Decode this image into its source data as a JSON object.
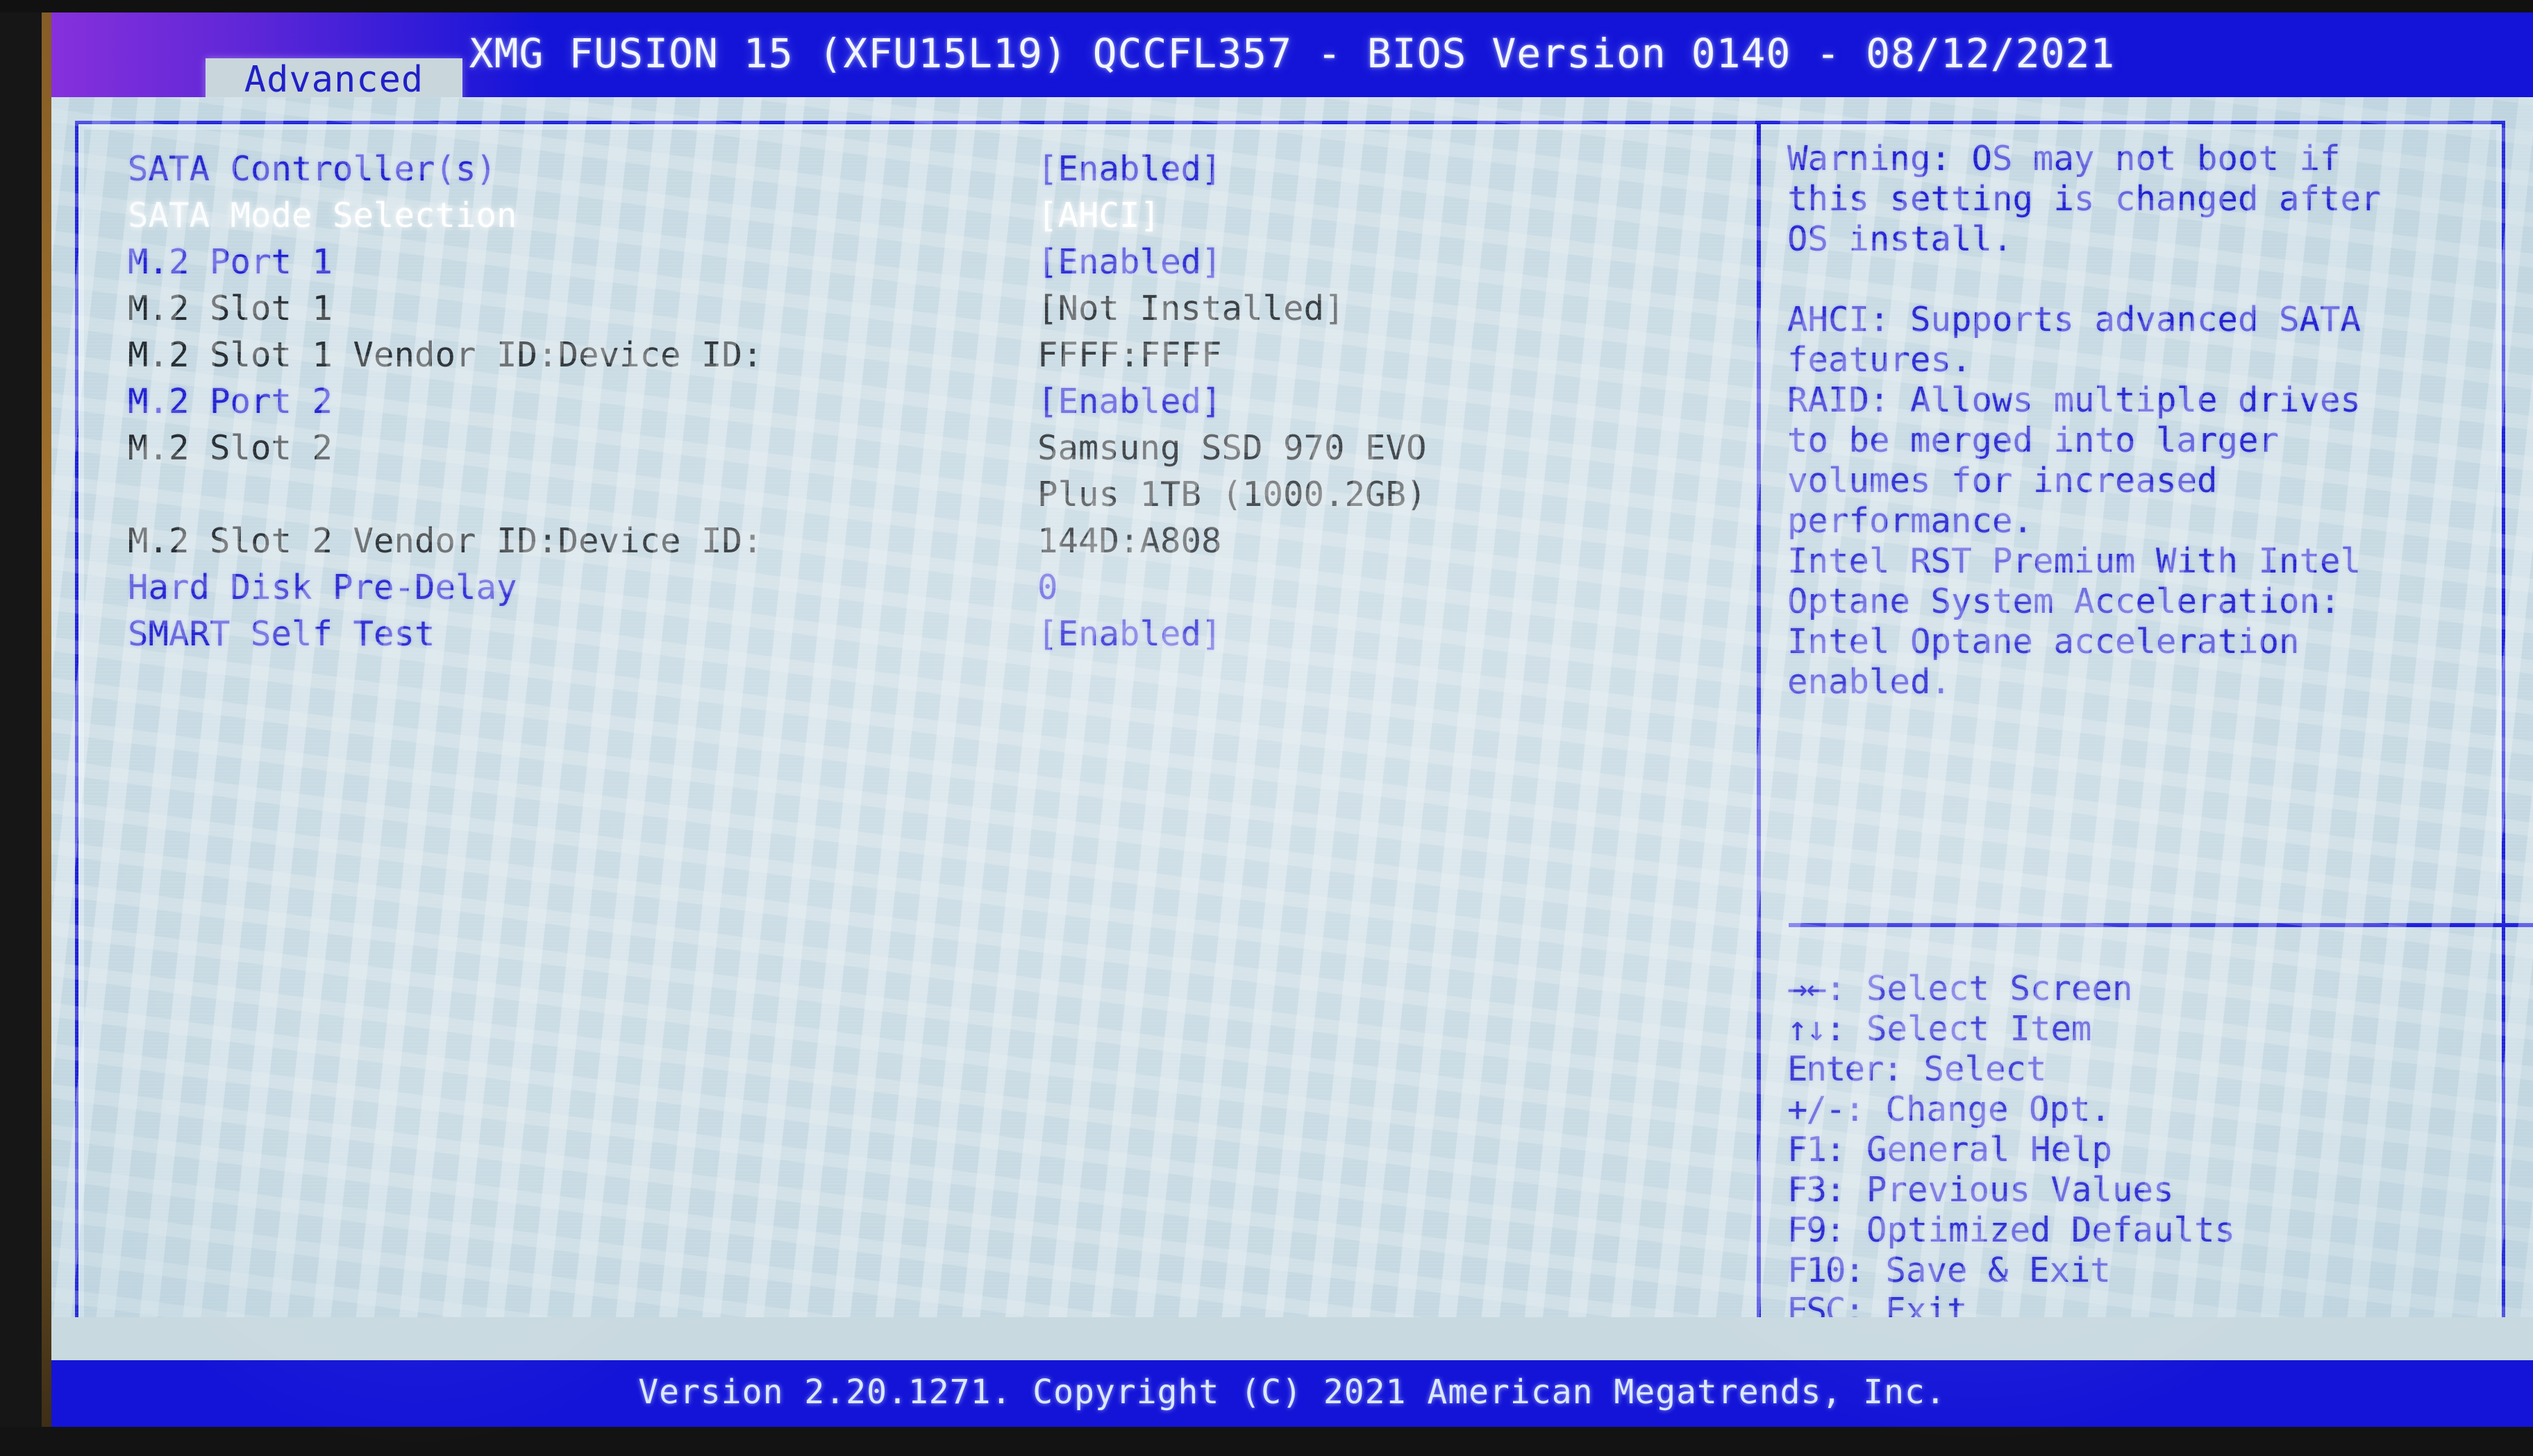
{
  "header": {
    "title": "XMG FUSION 15 (XFU15L19) QCCFL357 - BIOS Version 0140 - 08/12/2021",
    "active_tab": "Advanced",
    "accent_blue": "#1414d8",
    "option_blue": "#1f1fcf",
    "selected_white": "#ffffff",
    "info_dark": "#23292e",
    "screen_bg": "#c6d9e2"
  },
  "settings": [
    {
      "label": "SATA Controller(s)",
      "value": "[Enabled]",
      "label_style": "option",
      "value_style": "option"
    },
    {
      "label": "SATA Mode Selection",
      "value": "[AHCI]",
      "label_style": "selected",
      "value_style": "selected"
    },
    {
      "label": "M.2 Port 1",
      "value": "[Enabled]",
      "label_style": "option",
      "value_style": "option"
    },
    {
      "label": "M.2 Slot 1",
      "value": "[Not Installed]",
      "label_style": "info",
      "value_style": "info"
    },
    {
      "label": "M.2 Slot 1 Vendor ID:Device ID:",
      "value": "FFFF:FFFF",
      "label_style": "info",
      "value_style": "info"
    },
    {
      "label": "M.2 Port 2",
      "value": "[Enabled]",
      "label_style": "option",
      "value_style": "option"
    },
    {
      "label": "M.2 Slot 2",
      "value": "Samsung SSD 970 EVO\nPlus 1TB (1000.2GB)",
      "label_style": "info",
      "value_style": "info",
      "tall": true
    },
    {
      "label": "M.2 Slot 2 Vendor ID:Device ID:",
      "value": "144D:A808",
      "label_style": "info",
      "value_style": "info"
    },
    {
      "label": "Hard Disk Pre-Delay",
      "value": "0",
      "label_style": "option",
      "value_style": "option"
    },
    {
      "label": "SMART Self Test",
      "value": "[Enabled]",
      "label_style": "option",
      "value_style": "option"
    }
  ],
  "help": {
    "paragraphs": [
      "Warning: OS may not boot if\nthis setting is changed after\nOS install.",
      "AHCI: Supports advanced SATA\nfeatures.\nRAID: Allows multiple drives\nto be merged into larger\nvolumes for increased\nperformance.\nIntel RST Premium With Intel\nOptane System Acceleration:\nIntel Optane acceleration\nenabled."
    ]
  },
  "keys": [
    {
      "glyph": "→←",
      "label": ": Select Screen"
    },
    {
      "glyph": "↑↓",
      "label": ": Select Item"
    },
    {
      "glyph": "Enter",
      "label": ": Select"
    },
    {
      "glyph": "+/-",
      "label": ": Change Opt."
    },
    {
      "glyph": "F1",
      "label": ": General Help"
    },
    {
      "glyph": "F3",
      "label": ": Previous Values"
    },
    {
      "glyph": "F9",
      "label": ": Optimized Defaults"
    },
    {
      "glyph": "F10",
      "label": ": Save & Exit"
    },
    {
      "glyph": "ESC",
      "label": ": Exit"
    }
  ],
  "footer": {
    "copyright": "Version 2.20.1271. Copyright (C) 2021 American Megatrends, Inc."
  }
}
